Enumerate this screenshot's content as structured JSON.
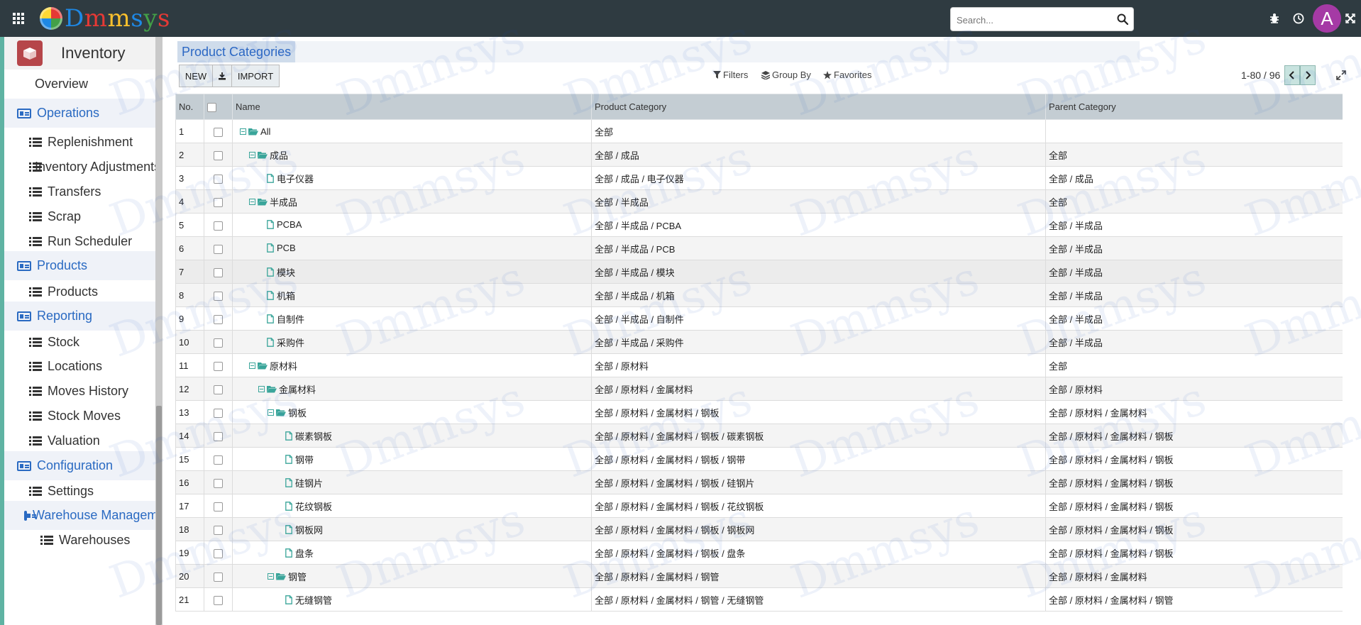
{
  "brand": {
    "name": "Dmmsys",
    "letter_colors": [
      "#1e88e5",
      "#e53935",
      "#fbc02d",
      "#1e88e5",
      "#43a047",
      "#e53935"
    ]
  },
  "search": {
    "placeholder": "Search..."
  },
  "user": {
    "initial": "A"
  },
  "app": {
    "title": "Inventory"
  },
  "sidebar": {
    "items": [
      {
        "label": "Overview",
        "kind": "top"
      },
      {
        "label": "Operations",
        "kind": "section"
      },
      {
        "label": "Replenishment",
        "kind": "sub"
      },
      {
        "label": "Inventory Adjustments",
        "kind": "sub"
      },
      {
        "label": "Transfers",
        "kind": "sub"
      },
      {
        "label": "Scrap",
        "kind": "sub"
      },
      {
        "label": "Run Scheduler",
        "kind": "sub"
      },
      {
        "label": "Products",
        "kind": "section"
      },
      {
        "label": "Products",
        "kind": "sub"
      },
      {
        "label": "Reporting",
        "kind": "section"
      },
      {
        "label": "Stock",
        "kind": "sub"
      },
      {
        "label": "Locations",
        "kind": "sub"
      },
      {
        "label": "Moves History",
        "kind": "sub"
      },
      {
        "label": "Stock Moves",
        "kind": "sub"
      },
      {
        "label": "Valuation",
        "kind": "sub"
      },
      {
        "label": "Configuration",
        "kind": "section"
      },
      {
        "label": "Settings",
        "kind": "sub"
      },
      {
        "label": "Warehouse Management",
        "kind": "subsection"
      },
      {
        "label": "Warehouses",
        "kind": "subsub"
      }
    ]
  },
  "page": {
    "breadcrumb": "Product Categories",
    "buttons": {
      "new": "NEW",
      "import": "IMPORT"
    },
    "controls": {
      "filters": "Filters",
      "group_by": "Group By",
      "favorites": "Favorites"
    },
    "pager": "1-80 / 96"
  },
  "table": {
    "headers": {
      "no": "No.",
      "name": "Name",
      "category": "Product Category",
      "parent": "Parent Category"
    },
    "rows": [
      {
        "no": "1",
        "name": "All",
        "level": 0,
        "folder": true,
        "category": "全部",
        "parent": ""
      },
      {
        "no": "2",
        "name": "成品",
        "level": 1,
        "folder": true,
        "category": "全部 / 成品",
        "parent": "全部"
      },
      {
        "no": "3",
        "name": "电子仪器",
        "level": 2,
        "folder": false,
        "category": "全部 / 成品 / 电子仪器",
        "parent": "全部 / 成品"
      },
      {
        "no": "4",
        "name": "半成品",
        "level": 1,
        "folder": true,
        "category": "全部 / 半成品",
        "parent": "全部"
      },
      {
        "no": "5",
        "name": "PCBA",
        "level": 2,
        "folder": false,
        "category": "全部 / 半成品 / PCBA",
        "parent": "全部 / 半成品"
      },
      {
        "no": "6",
        "name": "PCB",
        "level": 2,
        "folder": false,
        "category": "全部 / 半成品 / PCB",
        "parent": "全部 / 半成品"
      },
      {
        "no": "7",
        "name": "模块",
        "level": 2,
        "folder": false,
        "category": "全部 / 半成品 / 模块",
        "parent": "全部 / 半成品"
      },
      {
        "no": "8",
        "name": "机箱",
        "level": 2,
        "folder": false,
        "category": "全部 / 半成品 / 机箱",
        "parent": "全部 / 半成品"
      },
      {
        "no": "9",
        "name": "自制件",
        "level": 2,
        "folder": false,
        "category": "全部 / 半成品 / 自制件",
        "parent": "全部 / 半成品"
      },
      {
        "no": "10",
        "name": "采购件",
        "level": 2,
        "folder": false,
        "category": "全部 / 半成品 / 采购件",
        "parent": "全部 / 半成品"
      },
      {
        "no": "11",
        "name": "原材料",
        "level": 1,
        "folder": true,
        "category": "全部 / 原材料",
        "parent": "全部"
      },
      {
        "no": "12",
        "name": "金属材料",
        "level": 2,
        "folder": true,
        "category": "全部 / 原材料 / 金属材料",
        "parent": "全部 / 原材料"
      },
      {
        "no": "13",
        "name": "钢板",
        "level": 3,
        "folder": true,
        "category": "全部 / 原材料 / 金属材料 / 钢板",
        "parent": "全部 / 原材料 / 金属材料"
      },
      {
        "no": "14",
        "name": "碳素钢板",
        "level": 4,
        "folder": false,
        "category": "全部 / 原材料 / 金属材料 / 钢板 / 碳素钢板",
        "parent": "全部 / 原材料 / 金属材料 / 钢板"
      },
      {
        "no": "15",
        "name": "钢带",
        "level": 4,
        "folder": false,
        "category": "全部 / 原材料 / 金属材料 / 钢板 / 钢带",
        "parent": "全部 / 原材料 / 金属材料 / 钢板"
      },
      {
        "no": "16",
        "name": "硅钢片",
        "level": 4,
        "folder": false,
        "category": "全部 / 原材料 / 金属材料 / 钢板 / 硅钢片",
        "parent": "全部 / 原材料 / 金属材料 / 钢板"
      },
      {
        "no": "17",
        "name": "花纹钢板",
        "level": 4,
        "folder": false,
        "category": "全部 / 原材料 / 金属材料 / 钢板 / 花纹钢板",
        "parent": "全部 / 原材料 / 金属材料 / 钢板"
      },
      {
        "no": "18",
        "name": "钢板网",
        "level": 4,
        "folder": false,
        "category": "全部 / 原材料 / 金属材料 / 钢板 / 钢板网",
        "parent": "全部 / 原材料 / 金属材料 / 钢板"
      },
      {
        "no": "19",
        "name": "盘条",
        "level": 4,
        "folder": false,
        "category": "全部 / 原材料 / 金属材料 / 钢板 / 盘条",
        "parent": "全部 / 原材料 / 金属材料 / 钢板"
      },
      {
        "no": "20",
        "name": "钢管",
        "level": 3,
        "folder": true,
        "category": "全部 / 原材料 / 金属材料 / 钢管",
        "parent": "全部 / 原材料 / 金属材料"
      },
      {
        "no": "21",
        "name": "无缝钢管",
        "level": 4,
        "folder": false,
        "category": "全部 / 原材料 / 金属材料 / 钢管 / 无缝钢管",
        "parent": "全部 / 原材料 / 金属材料 / 钢管"
      }
    ]
  },
  "colors": {
    "topbar": "#2f3b41",
    "accent": "#2a6ac2",
    "tree_icon": "#3aa59a",
    "avatar": "#a53aa5",
    "app_icon": "#b6464a"
  }
}
